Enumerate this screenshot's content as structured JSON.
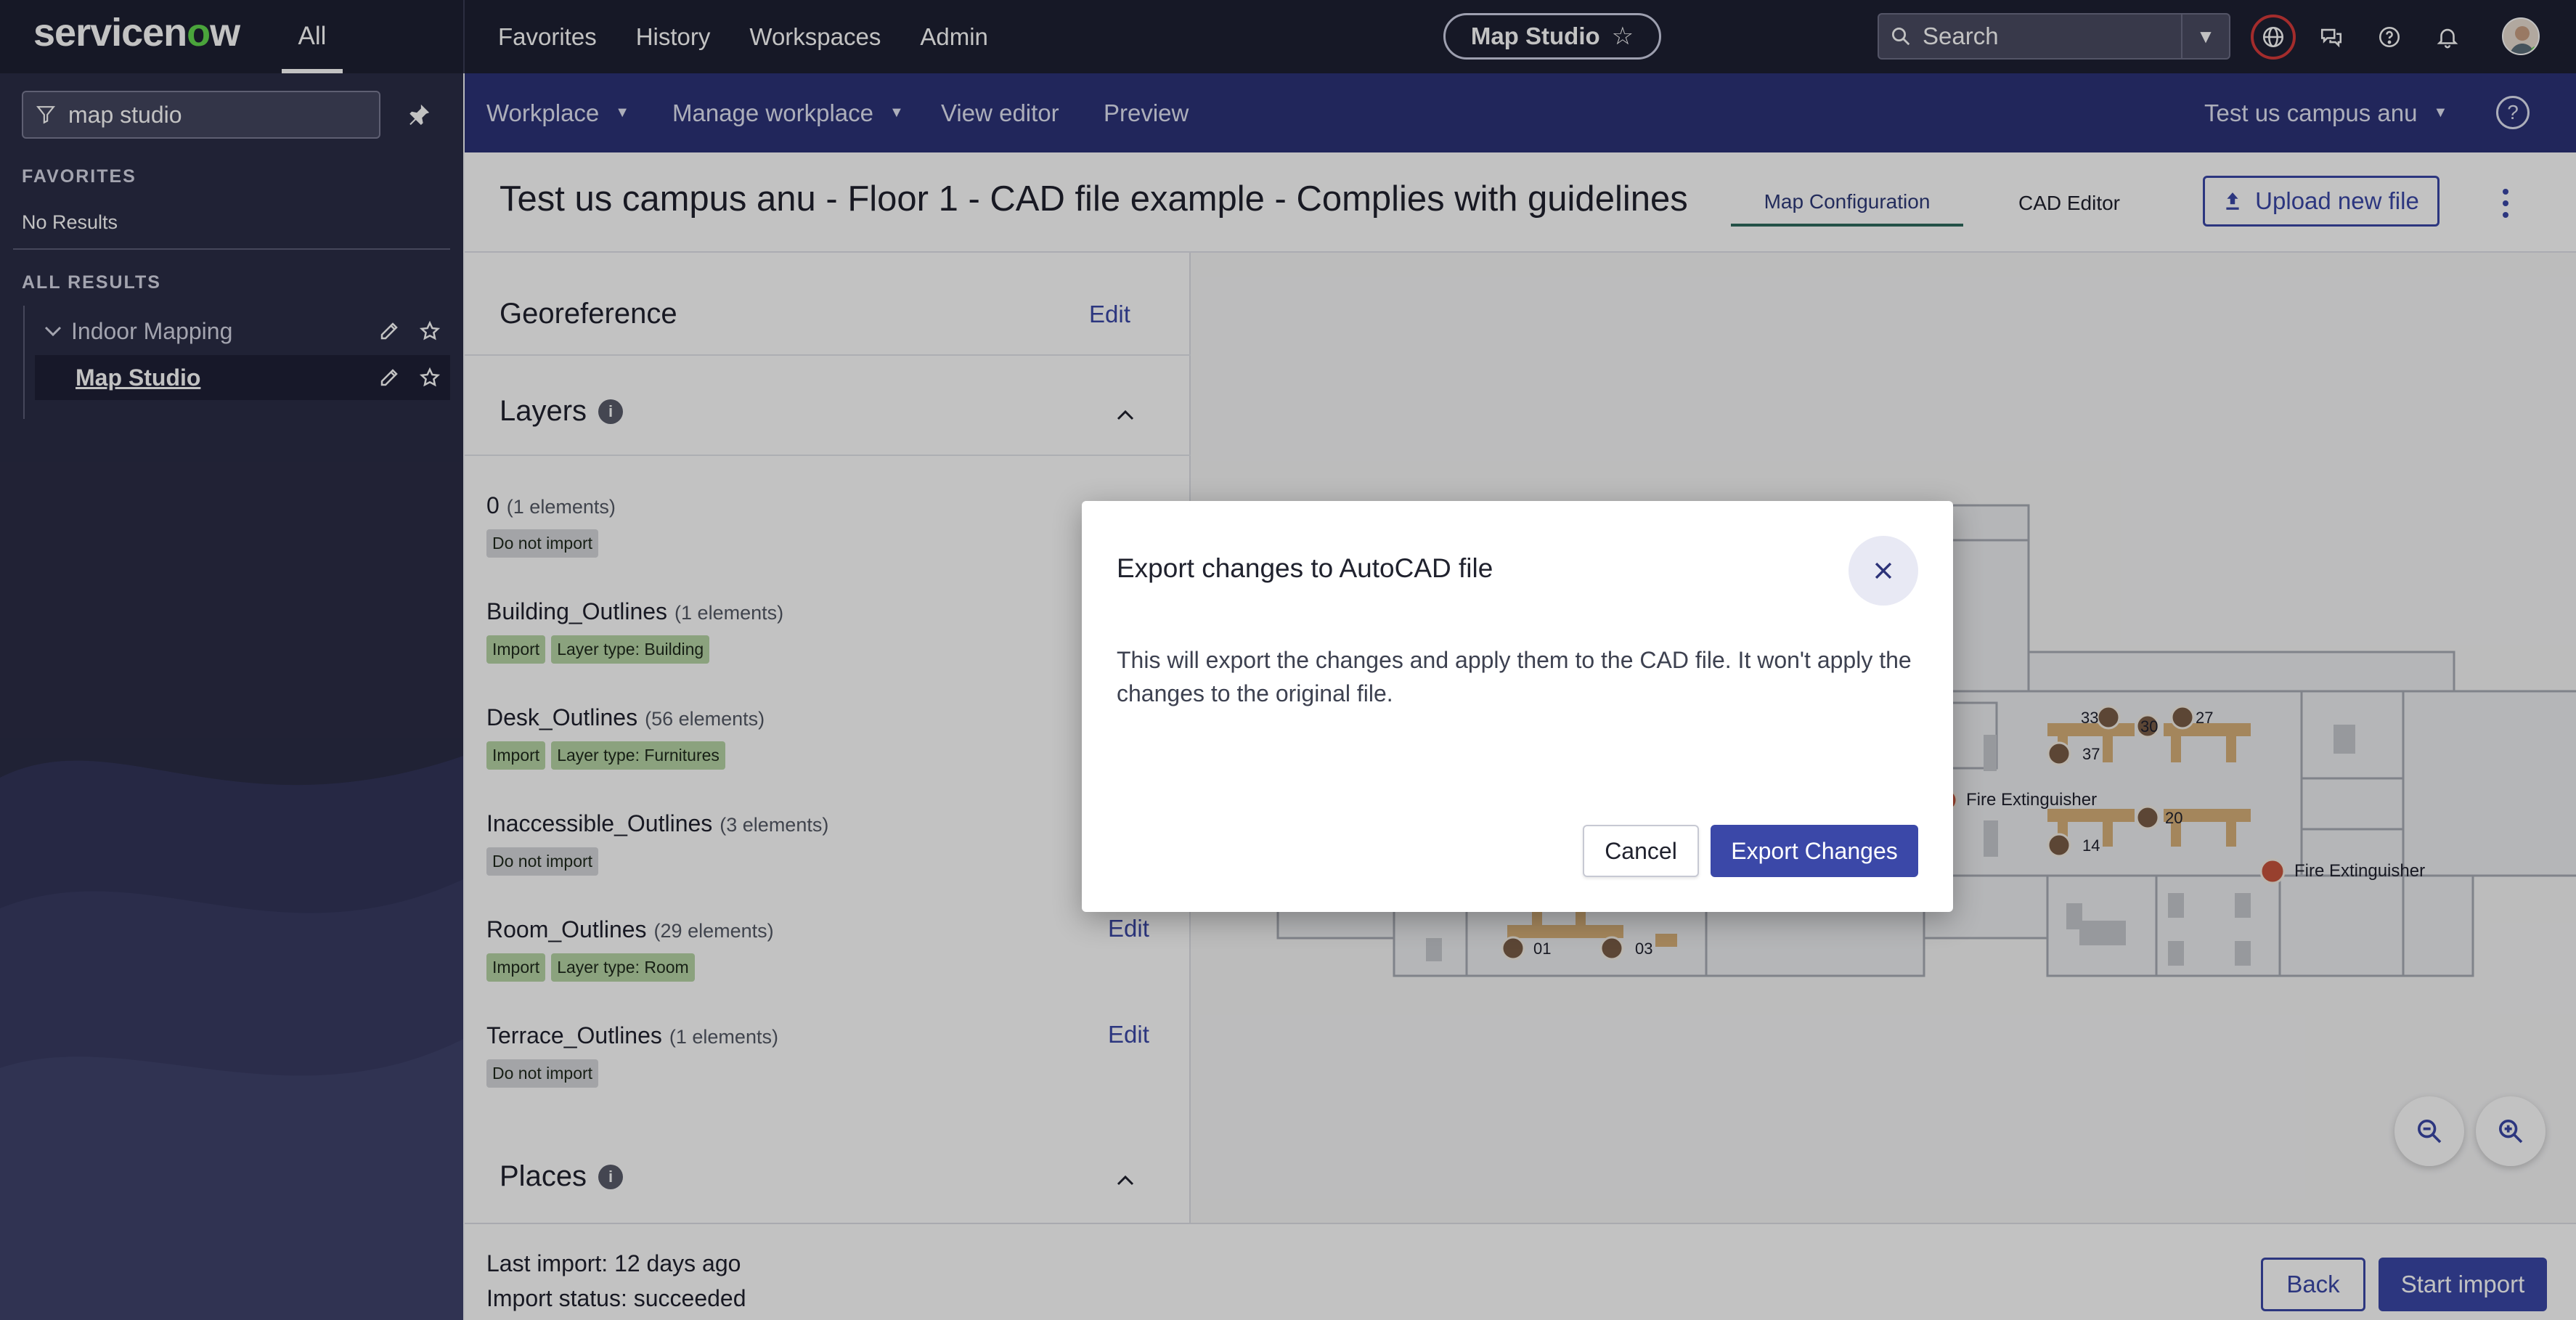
{
  "topnav": {
    "logo": "servicenow",
    "all_tab": "All",
    "links": [
      "Favorites",
      "History",
      "Workspaces",
      "Admin"
    ],
    "app_pill": "Map Studio",
    "search_placeholder": "Search"
  },
  "sidebar": {
    "filter_value": "map studio",
    "favorites_heading": "FAVORITES",
    "favorites_empty": "No Results",
    "all_results_heading": "ALL RESULTS",
    "items": [
      {
        "label": "Indoor Mapping"
      },
      {
        "label": "Map Studio"
      }
    ]
  },
  "subnav": {
    "workplace": "Workplace",
    "manage_workplace": "Manage workplace",
    "view_editor": "View editor",
    "preview": "Preview",
    "campus_selector": "Test us campus anu"
  },
  "page": {
    "title": "Test us campus anu - Floor 1 - CAD file example - Complies with guidelines",
    "tabs": [
      "Map Configuration",
      "CAD Editor"
    ],
    "active_tab": "Map Configuration",
    "upload_button": "Upload new file"
  },
  "panel": {
    "georeference": {
      "title": "Georeference",
      "edit": "Edit"
    },
    "layers": {
      "title": "Layers",
      "items": [
        {
          "name": "0",
          "count": "(1 elements)",
          "tags": [
            {
              "text": "Do not import",
              "style": "gray"
            }
          ],
          "edit": ""
        },
        {
          "name": "Building_Outlines",
          "count": "(1 elements)",
          "tags": [
            {
              "text": "Import",
              "style": "green"
            },
            {
              "text": "Layer type: Building",
              "style": "green"
            }
          ],
          "edit": ""
        },
        {
          "name": "Desk_Outlines",
          "count": "(56 elements)",
          "tags": [
            {
              "text": "Import",
              "style": "green"
            },
            {
              "text": "Layer type: Furnitures",
              "style": "green"
            }
          ],
          "edit": ""
        },
        {
          "name": "Inaccessible_Outlines",
          "count": "(3 elements)",
          "tags": [
            {
              "text": "Do not import",
              "style": "gray"
            }
          ],
          "edit": ""
        },
        {
          "name": "Room_Outlines",
          "count": "(29 elements)",
          "tags": [
            {
              "text": "Import",
              "style": "green"
            },
            {
              "text": "Layer type: Room",
              "style": "green"
            }
          ],
          "edit": "Edit"
        },
        {
          "name": "Terrace_Outlines",
          "count": "(1 elements)",
          "tags": [
            {
              "text": "Do not import",
              "style": "gray"
            }
          ],
          "edit": "Edit"
        }
      ]
    },
    "places": {
      "title": "Places"
    }
  },
  "map": {
    "labels": {
      "fire_extinguisher": "Fire Extinguisher",
      "desk_numbers": [
        "33",
        "30",
        "27",
        "37",
        "20",
        "14",
        "01",
        "03"
      ]
    }
  },
  "footer": {
    "last_import": "Last import: 12 days ago",
    "import_status": "Import status: succeeded",
    "back": "Back",
    "start_import": "Start import"
  },
  "modal": {
    "title": "Export changes to AutoCAD file",
    "body": "This will export the changes and apply them to the CAD file. It won't apply the changes to the original file.",
    "cancel": "Cancel",
    "confirm": "Export Changes"
  },
  "colors": {
    "topnav_bg": "#1e2033",
    "subnav_bg": "#2c3278",
    "primary": "#3b48a8",
    "logo_accent": "#62d84e",
    "fire_marker": "#c8553d",
    "desk_fill": "#d8b07a"
  }
}
